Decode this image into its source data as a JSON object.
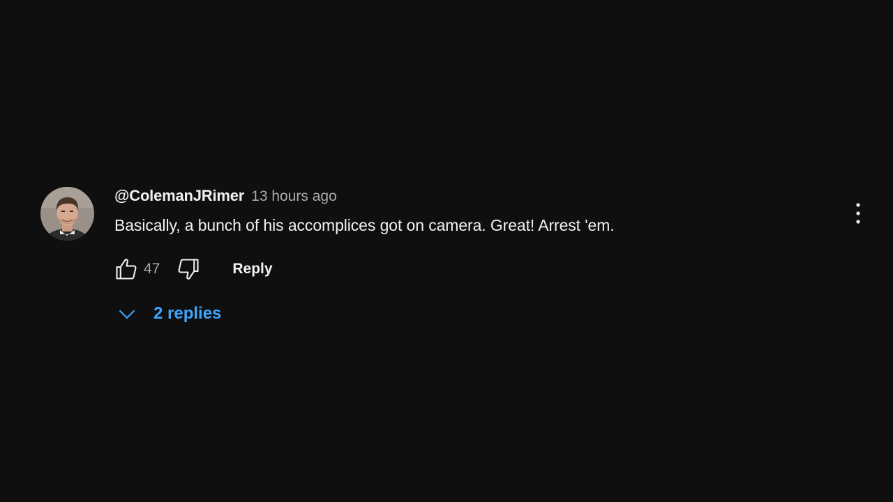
{
  "comment": {
    "author": "@ColemanJRimer",
    "timestamp": "13 hours ago",
    "text": "Basically, a bunch of his accomplices got on camera. Great! Arrest 'em.",
    "like_count": "47",
    "reply_label": "Reply",
    "replies_label": "2 replies"
  },
  "icons": {
    "like": "thumbs-up-icon",
    "dislike": "thumbs-down-icon",
    "expand": "chevron-down-icon",
    "menu": "more-vertical-icon"
  },
  "colors": {
    "background": "#0f0f0f",
    "primary_text": "#f1f1f1",
    "secondary_text": "#aaaaaa",
    "link": "#3ea6ff"
  }
}
